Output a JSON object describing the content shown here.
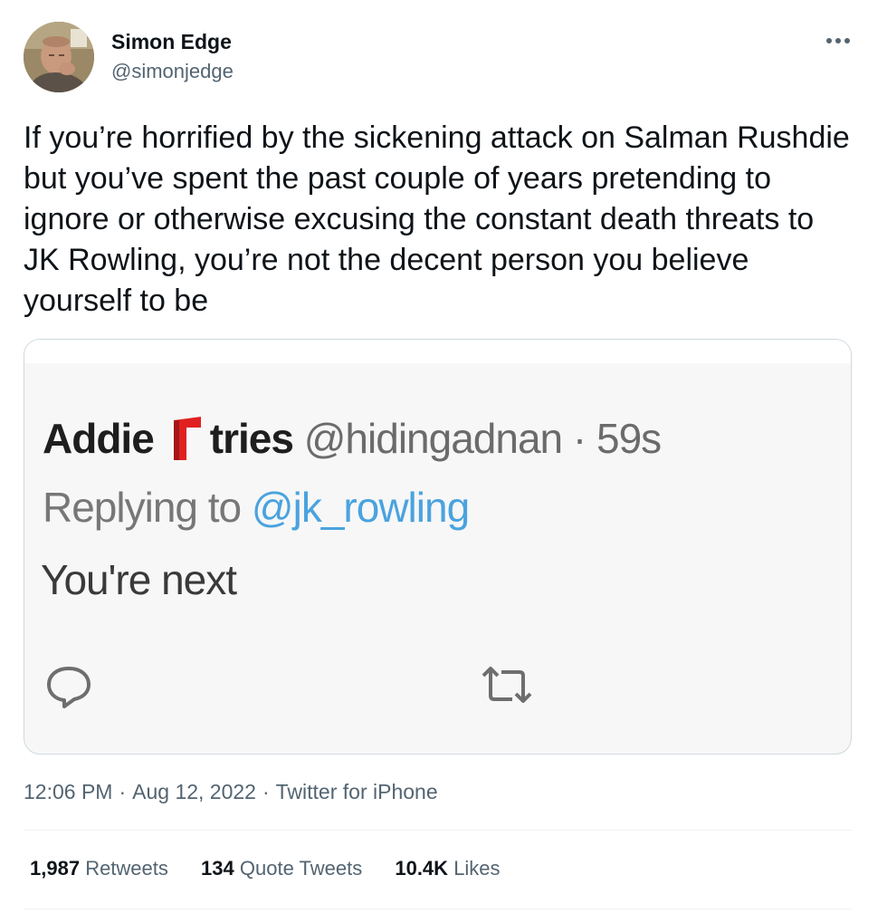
{
  "author": {
    "display_name": "Simon Edge",
    "handle": "@simonjedge"
  },
  "tweet_text": "If you’re horrified by the sickening attack on Salman Rushdie but you’ve spent the past couple of years pretending to ignore or otherwise excusing the constant death threats to JK Rowling, you’re not the decent person you believe yourself to be",
  "quoted_screenshot": {
    "name": "Addie",
    "name_suffix": "tries",
    "handle": "@hidingadnan",
    "separator": "·",
    "time": "59s",
    "replying_prefix": "Replying to",
    "replying_mention": "@jk_rowling",
    "text": "You're next",
    "flag_color": "#e02020"
  },
  "meta": {
    "time": "12:06 PM",
    "date": "Aug 12, 2022",
    "source": "Twitter for iPhone",
    "separator": "·"
  },
  "stats": {
    "retweets_count": "1,987",
    "retweets_label": "Retweets",
    "quotes_count": "134",
    "quotes_label": "Quote Tweets",
    "likes_count": "10.4K",
    "likes_label": "Likes"
  },
  "colors": {
    "text_primary": "#0f1419",
    "text_secondary": "#536471",
    "border": "#cfd9de",
    "mention_blue": "#4aa3df"
  },
  "icons": {
    "more": "more-horizontal-icon",
    "reply": "reply-bubble-icon",
    "retweet": "retweet-icon"
  }
}
